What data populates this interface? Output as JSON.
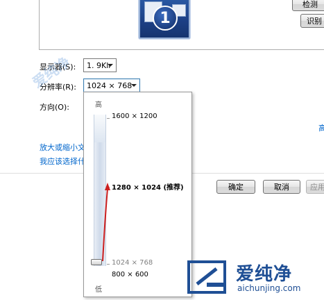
{
  "top": {
    "detect_label": "检测",
    "identify_label": "识别",
    "monitor_number": "1"
  },
  "settings": {
    "display_label": "显示器(S):",
    "display_value": "1. 9Klr",
    "resolution_label": "分辨率(R):",
    "resolution_value": "1024 × 768",
    "orientation_label": "方向(O):"
  },
  "links": {
    "enlarge_text": "放大或缩小文本",
    "which_settings": "我应该选择什么",
    "advanced_partial": "高"
  },
  "buttons": {
    "ok": "确定",
    "cancel": "取消",
    "apply": "应用"
  },
  "slider": {
    "high_label": "高",
    "low_label": "低",
    "current_fraction": 0.1,
    "resolutions": [
      {
        "label": "1600 × 1200",
        "style": "normal"
      },
      {
        "label": "1280 × 1024 (推荐)",
        "style": "bold"
      },
      {
        "label": "1024 × 768",
        "style": "gray"
      },
      {
        "label": "800 × 600",
        "style": "normal"
      }
    ]
  },
  "watermark": {
    "title": "爱纯净",
    "url": "aichunjing.com",
    "faint": "爱纯净"
  },
  "colors": {
    "annotation_arrow": "#cc1f1f",
    "link": "#0066cc",
    "watermark": "#1f4f95"
  }
}
